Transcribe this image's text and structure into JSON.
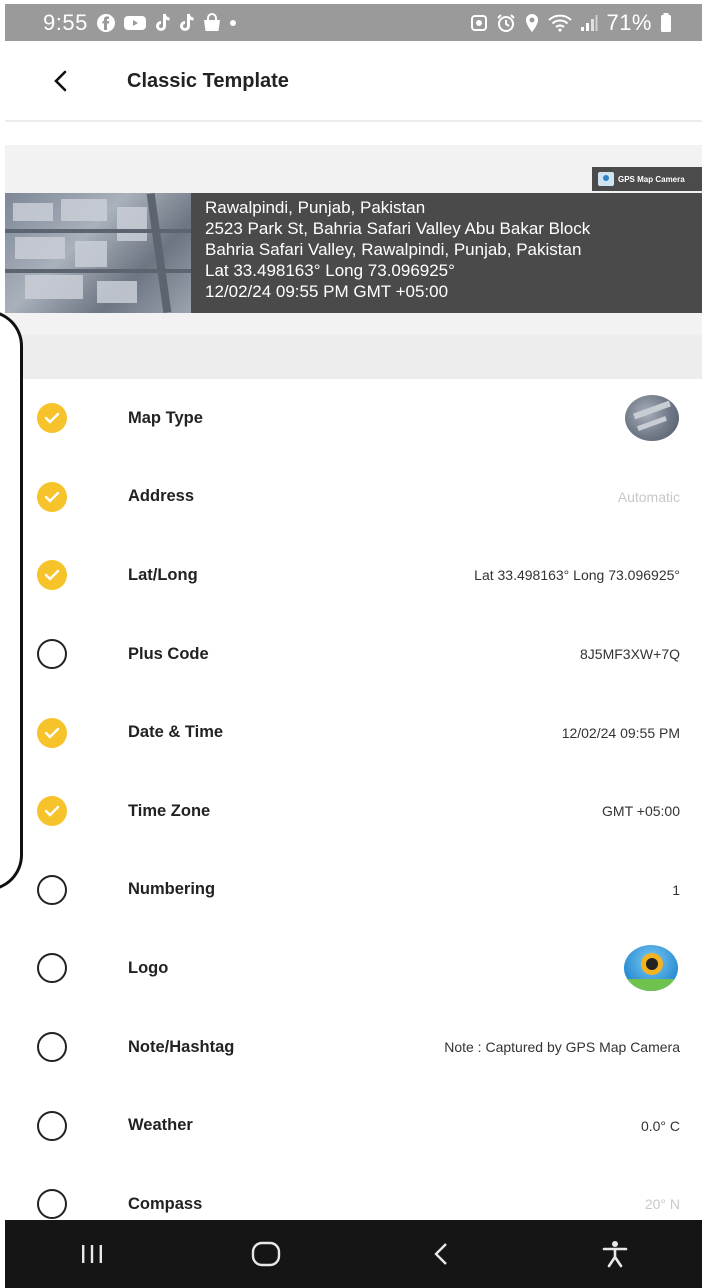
{
  "status_bar": {
    "time": "9:55",
    "left_icons": [
      "facebook-icon",
      "youtube-icon",
      "tiktok-icon",
      "tiktok-icon",
      "shopping-bag-icon"
    ],
    "right_icons": [
      "screenshot-icon",
      "alarm-icon",
      "location-icon",
      "wifi-icon",
      "signal-icon"
    ],
    "battery": "71%"
  },
  "header": {
    "title": "Classic Template"
  },
  "preview": {
    "badge": "GPS Map Camera",
    "lines": [
      "Rawalpindi, Punjab, Pakistan",
      "2523 Park St, Bahria Safari Valley Abu Bakar Block",
      "Bahria Safari Valley, Rawalpindi, Punjab, Pakistan",
      "Lat 33.498163° Long 73.096925°",
      "12/02/24 09:55 PM GMT +05:00"
    ]
  },
  "options": [
    {
      "label": "Map Type",
      "checked": true,
      "value": "",
      "kind": "map"
    },
    {
      "label": "Address",
      "checked": true,
      "value": "Automatic",
      "muted": true
    },
    {
      "label": "Lat/Long",
      "checked": true,
      "value": "Lat 33.498163° Long 73.096925°"
    },
    {
      "label": "Plus Code",
      "checked": false,
      "value": "8J5MF3XW+7Q"
    },
    {
      "label": "Date & Time",
      "checked": true,
      "value": "12/02/24 09:55 PM"
    },
    {
      "label": "Time Zone",
      "checked": true,
      "value": "GMT +05:00"
    },
    {
      "label": "Numbering",
      "checked": false,
      "value": "1"
    },
    {
      "label": "Logo",
      "checked": false,
      "value": "",
      "kind": "logo"
    },
    {
      "label": "Note/Hashtag",
      "checked": false,
      "value": "Note : Captured by GPS Map Camera"
    },
    {
      "label": "Weather",
      "checked": false,
      "value": "0.0° C"
    },
    {
      "label": "Compass",
      "checked": false,
      "value": "20° N",
      "muted": true
    }
  ],
  "nav": {
    "buttons": [
      "recent-apps-icon",
      "home-icon",
      "back-icon",
      "accessibility-icon"
    ]
  },
  "colors": {
    "check_on": "#f6c32a",
    "stamp_bg": "#4a4a4a",
    "status_bg": "#9a9a9a",
    "nav_bg": "#151515"
  }
}
